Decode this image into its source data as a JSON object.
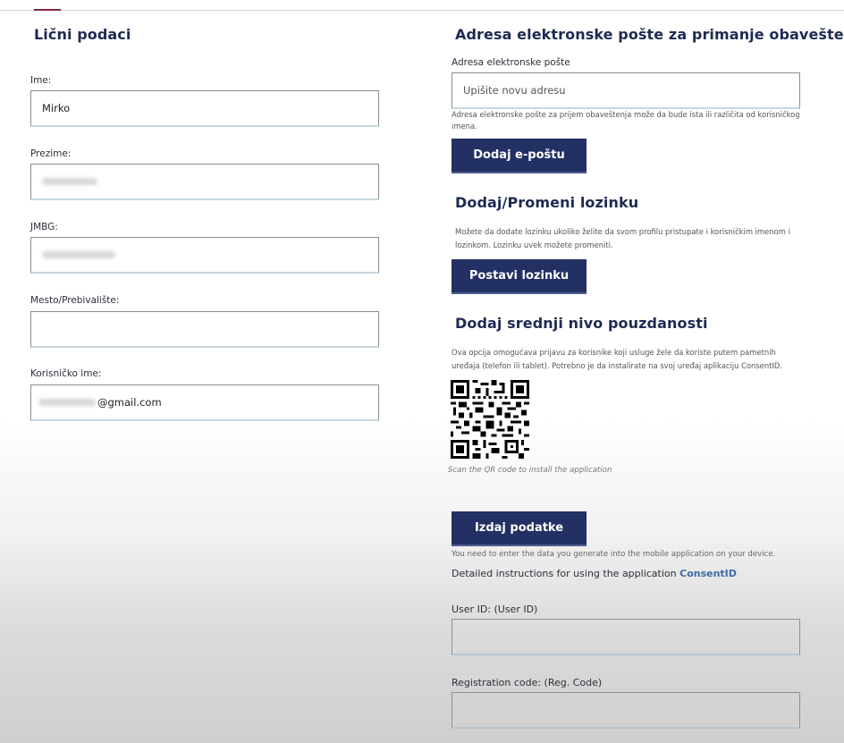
{
  "personal": {
    "title": "Lični podaci",
    "fields": [
      {
        "label": "Ime:",
        "value": "Mirko"
      },
      {
        "label": "Prezime:",
        "value": ""
      },
      {
        "label": "JMBG:",
        "value": ""
      },
      {
        "label": "Mesto/Prebivalište:",
        "value": ""
      },
      {
        "label": "Korisničko ime:",
        "value_suffix": "@gmail.com"
      }
    ]
  },
  "email": {
    "title": "Adresa elektronske pošte za primanje obaveštenja",
    "label": "Adresa elektronske pošte",
    "placeholder": "Upišite novu adresu",
    "help": "Adresa elektronske pošte za prijem obaveštenja može da bude ista ili različita od korisničkog imena.",
    "button": "Dodaj e-poštu"
  },
  "password": {
    "title": "Dodaj/Promeni lozinku",
    "text": "Možete da dodate lozinku ukoliko želite da svom profilu pristupate i korisničkim imenom i lozinkom. Lozinku uvek možete promeniti.",
    "button": "Postavi lozinku"
  },
  "trust": {
    "title": "Dodaj srednji nivo pouzdanosti",
    "text": "Ova opcija omogućava prijavu za korisnike koji usluge žele da koriste putem pametnih uređaja (telefon ili tablet). Potrebno je da instalirate na svoj uređaj aplikaciju ConsentID.",
    "qr_icon": "qr-code-icon",
    "qr_caption": "Scan the QR code to install the application",
    "button": "Izdaj podatke",
    "note": "You need to enter the data you generate into the mobile application on your device.",
    "detail_text": "Detailed instructions for using the application ",
    "detail_link": "ConsentID",
    "user_id_label": "User ID: (User ID)",
    "reg_code_label": "Registration code: (Reg. Code)"
  }
}
